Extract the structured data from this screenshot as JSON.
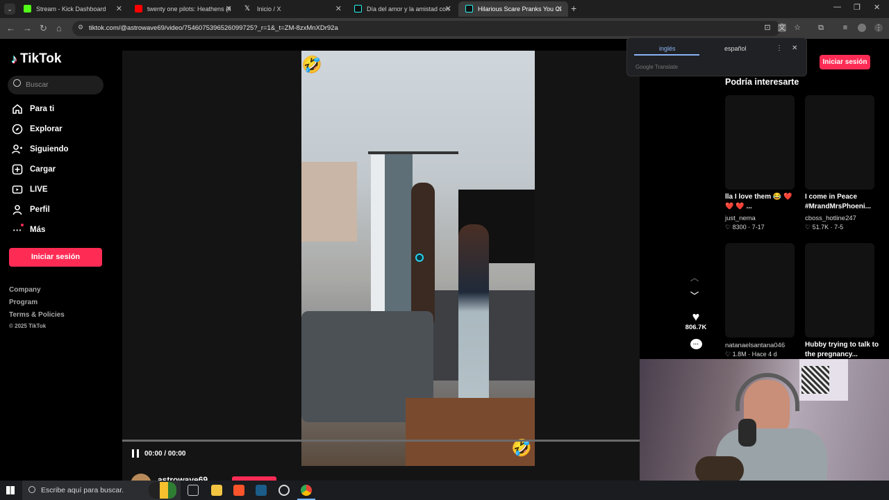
{
  "browser": {
    "tabs": [
      {
        "label": "Stream - Kick Dashboard",
        "favicon_color": "#53fc18"
      },
      {
        "label": "twenty one pilots: Heathens (fr",
        "favicon_color": "#ff0000"
      },
      {
        "label": "Inicio / X",
        "favicon_color": "#ffffff"
      },
      {
        "label": "Día del amor y la amistad con F",
        "favicon_color": "#25f4ee"
      },
      {
        "label": "Hilarious Scare Pranks You Can",
        "favicon_color": "#25f4ee"
      }
    ],
    "url": "tiktok.com/@astrowave69/video/7546075396526099725?_r=1&_t=ZM-8zxMnXDr92a"
  },
  "translate": {
    "lang_source": "inglés",
    "lang_target": "español",
    "brand": "Google Translate"
  },
  "tiktok": {
    "logo_text": "TikTok",
    "search_placeholder": "Buscar",
    "nav": [
      "Para ti",
      "Explorar",
      "Siguiendo",
      "Cargar",
      "LIVE",
      "Perfil",
      "Más"
    ],
    "login_label": "Iniciar sesión",
    "footer": {
      "company": "Company",
      "program": "Program",
      "terms": "Terms & Policies",
      "copyright": "© 2025 TikTok"
    },
    "accent": "#fe2c55"
  },
  "player": {
    "time": "00:00 / 00:00",
    "likes": "806.7K",
    "username": "astrowave69"
  },
  "suggestions": {
    "title": "Podría interesarte",
    "cards": [
      {
        "title": "lla I love them 😂 ❤️ ❤️ ❤️ ...",
        "user": "just_nema",
        "meta": "♡ 8300 · 7-17"
      },
      {
        "title": "I come in Peace #MrandMrsPhoeni...",
        "user": "cboss_hotline247",
        "meta": "♡ 51.7K · 7-5"
      },
      {
        "title": "",
        "user": "natanaelsantana046",
        "meta": "♡ 1.8M · Hace 4 d"
      },
      {
        "title": "Hubby trying to talk to the pregnancy...",
        "user": "",
        "meta": ""
      }
    ]
  },
  "taskbar": {
    "search_placeholder": "Escribe aquí para buscar."
  }
}
